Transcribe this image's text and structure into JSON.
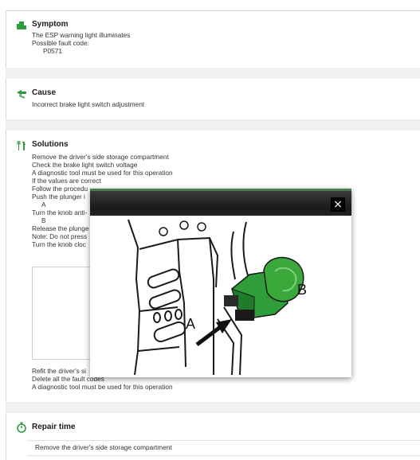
{
  "symptom": {
    "icon": "symptom-icon",
    "title": "Symptom",
    "lines": [
      "The ESP warning light illuminates",
      "Possible fault code:",
      "P0571"
    ]
  },
  "cause": {
    "icon": "cause-icon",
    "title": "Cause",
    "lines": [
      "Incorrect brake light switch adjustment"
    ]
  },
  "solutions": {
    "icon": "tools-icon",
    "title": "Solutions",
    "lines": [
      "Remove the driver's side storage compartment",
      "Check the brake light switch voltage",
      "A diagnostic tool must be used for this operation",
      "If the values are correct",
      "Follow the procedu",
      "Push the plunger i",
      "A",
      "Turn the knob anti-",
      "B",
      "Release the plunge",
      "Note: Do not press",
      "Turn the knob cloc"
    ],
    "after_lines": [
      "Refit the driver's si",
      "Delete all the fault codes",
      "A diagnostic tool must be used for this operation"
    ]
  },
  "repair_time": {
    "icon": "stopwatch-icon",
    "title": "Repair time",
    "row": "Remove the driver's side storage compartment"
  },
  "modal": {
    "close_label": "×",
    "image_labels": {
      "a": "A",
      "b": "B"
    }
  },
  "colors": {
    "accent_green": "#2e9e3a",
    "modal_header": "#1f1f1f",
    "switch_green": "#3aa83a"
  }
}
